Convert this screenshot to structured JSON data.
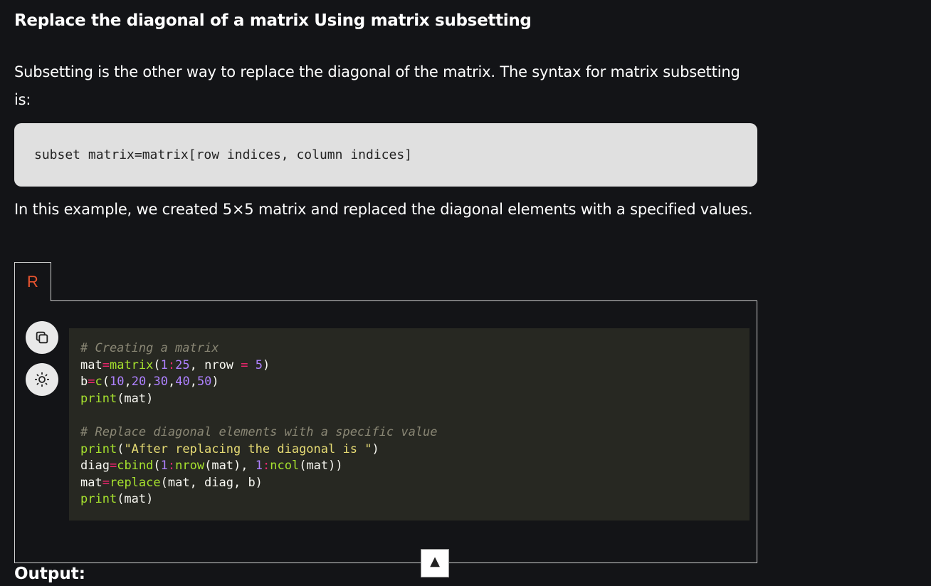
{
  "article": {
    "title": "Replace the diagonal of a matrix Using matrix subsetting",
    "paragraph1": "Subsetting is the other way to replace the diagonal of the matrix. The syntax for matrix subsetting is:",
    "syntax": "subset matrix=matrix[row indices, column indices]",
    "paragraph2": "In this example, we created 5×5 matrix and replaced the diagonal elements with a specified values.",
    "output_heading": "Output:"
  },
  "code_panel": {
    "language_tab": "R",
    "copy_icon": "copy-icon",
    "theme_icon": "sun-icon",
    "code": {
      "l1": "# Creating a matrix",
      "l2_var": "mat",
      "l2_op": "=",
      "l2_fn": "matrix",
      "l2_p1": "(",
      "l2_n1": "1",
      "l2_op2": ":",
      "l2_n2": "25",
      "l2_p2": ", nrow ",
      "l2_op3": "=",
      "l2_sp": " ",
      "l2_n3": "5",
      "l2_p3": ")",
      "l3_var": "b",
      "l3_op": "=",
      "l3_fn": "c",
      "l3_p1": "(",
      "l3_n1": "10",
      "l3_c1": ",",
      "l3_n2": "20",
      "l3_c2": ",",
      "l3_n3": "30",
      "l3_c3": ",",
      "l3_n4": "40",
      "l3_c4": ",",
      "l3_n5": "50",
      "l3_p2": ")",
      "l4_fn": "print",
      "l4_rest": "(mat)",
      "l6": "# Replace diagonal elements with a specific value",
      "l7_fn": "print",
      "l7_p1": "(",
      "l7_str": "\"After replacing the diagonal is \"",
      "l7_p2": ")",
      "l8_var": "diag",
      "l8_op": "=",
      "l8_fn": "cbind",
      "l8_p1": "(",
      "l8_n1": "1",
      "l8_op2": ":",
      "l8_fn2": "nrow",
      "l8_p2": "(mat), ",
      "l8_n2": "1",
      "l8_op3": ":",
      "l8_fn3": "ncol",
      "l8_p3": "(mat))",
      "l9_var": "mat",
      "l9_op": "=",
      "l9_fn": "replace",
      "l9_rest": "(mat, diag, b)",
      "l10_fn": "print",
      "l10_rest": "(mat)"
    }
  },
  "scroll_top": {
    "label": "▲"
  },
  "colors": {
    "background": "#131417",
    "code_background": "#272822",
    "language_accent": "#e8542f"
  }
}
